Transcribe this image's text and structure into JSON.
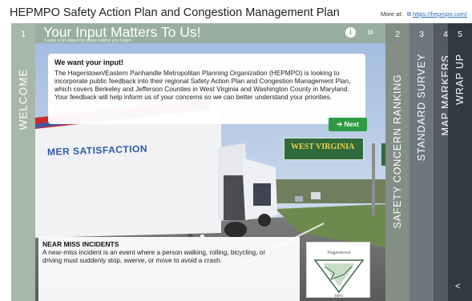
{
  "page": {
    "title": "HEPMPO Safety Action Plan and Congestion Management Plan",
    "more_at_label": "More at:",
    "more_at_link": "https://hepmpo.com/"
  },
  "welcome": {
    "tab_number": "1",
    "tab_label": "WELCOME",
    "title": "Your Input Matters To Us!",
    "subtitle": "Learn a bit about the plans before you begin.",
    "info_icon": "info-icon",
    "skip_icon": "double-chevron-right-icon"
  },
  "intro_card": {
    "heading": "We want your input!",
    "body": "The Hagerstown/Eastern Panhandle Metropolitan Planning Organization (HEPMPO) is looking to incorporate public feedback into their regional Safety Action Plan and Congestion Management Plan, which covers Berkeley and Jefferson Counties in West Virginia and Washington County in Maryland. Your feedback will help inform us of your concerns so we can better understand your priorities.",
    "next_label": "➔ Next"
  },
  "scene": {
    "truck_slogan": "MER SATISFACTION",
    "sign_text": "WEST VIRGINIA"
  },
  "carousel": {
    "dots": [
      "active",
      "idle"
    ]
  },
  "near_miss": {
    "title": "NEAR MISS INCIDENTS",
    "body": "A near-miss incident is an event where a person walking, rolling, bicycling, or driving must suddenly stop, swerve, or move to avoid a crash."
  },
  "logo": {
    "name": "Hagerstown Eastern Panhandle MPO",
    "text_top": "Hagerstown",
    "text_bottom": "MPO"
  },
  "tabs": [
    {
      "number": "2",
      "label": "SAFETY CONCERN RANKING"
    },
    {
      "number": "3",
      "label": "STANDARD SURVEY"
    },
    {
      "number": "4",
      "label": "MAP MARKERS"
    },
    {
      "number": "5",
      "label": "WRAP UP"
    }
  ],
  "share_icon": "share-icon",
  "colors": {
    "welcome_tab": "#a7b7a8",
    "tab2": "#848e87",
    "tab3": "#6d757f",
    "tab4": "#535a64",
    "tab5": "#313942",
    "next_button": "#2e9a43",
    "link": "#2a6db5"
  }
}
